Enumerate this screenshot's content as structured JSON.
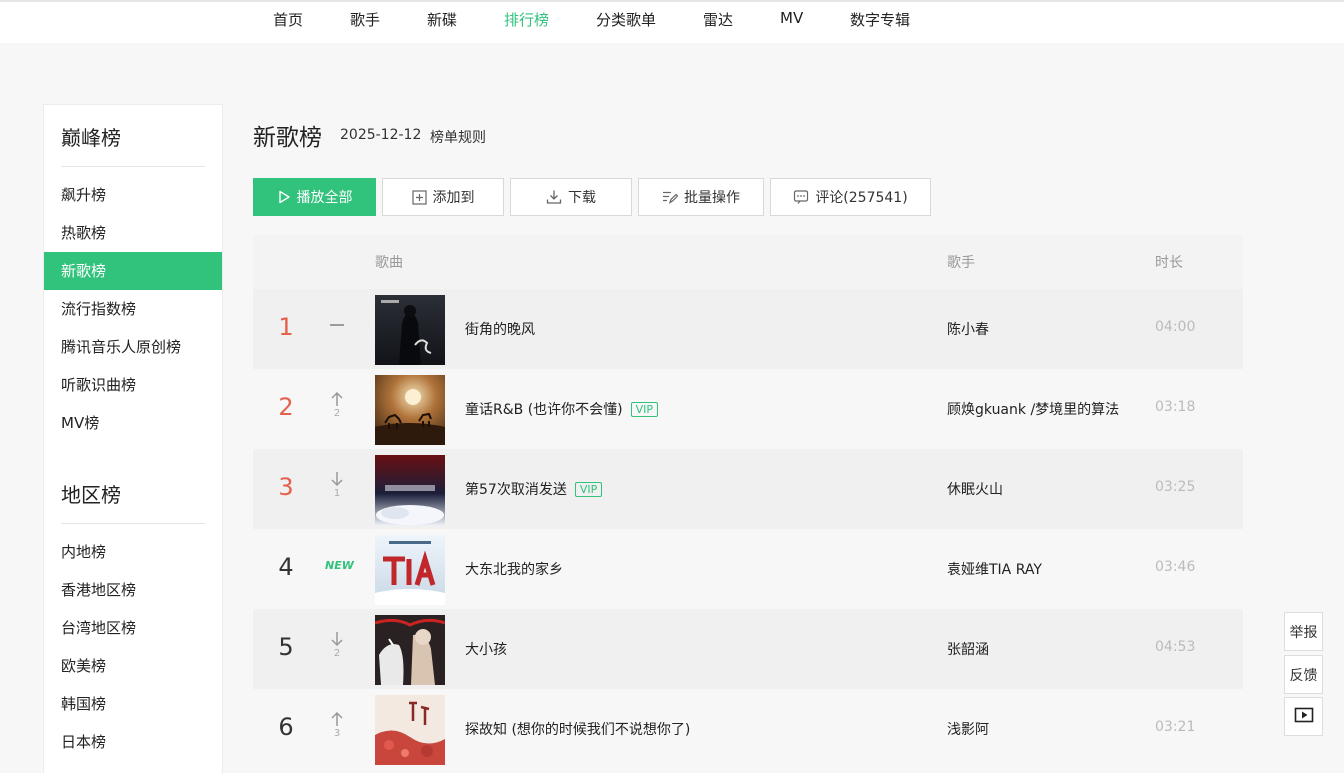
{
  "nav": {
    "items": [
      {
        "label": "首页",
        "active": false
      },
      {
        "label": "歌手",
        "active": false
      },
      {
        "label": "新碟",
        "active": false
      },
      {
        "label": "排行榜",
        "active": true
      },
      {
        "label": "分类歌单",
        "active": false
      },
      {
        "label": "雷达",
        "active": false
      },
      {
        "label": "MV",
        "active": false
      },
      {
        "label": "数字专辑",
        "active": false
      }
    ]
  },
  "sidebar": {
    "groups": [
      {
        "title": "巅峰榜",
        "items": [
          "飙升榜",
          "热歌榜",
          "新歌榜",
          "流行指数榜",
          "腾讯音乐人原创榜",
          "听歌识曲榜",
          "MV榜"
        ],
        "active": "新歌榜"
      },
      {
        "title": "地区榜",
        "items": [
          "内地榜",
          "香港地区榜",
          "台湾地区榜",
          "欧美榜",
          "韩国榜",
          "日本榜"
        ]
      }
    ]
  },
  "main": {
    "title": "新歌榜",
    "date": "2025-12-12",
    "rule_link": "榜单规则"
  },
  "toolbar": {
    "play_all": "播放全部",
    "add_to": "添加到",
    "download": "下载",
    "batch": "批量操作",
    "comment": "评论(257541)"
  },
  "table": {
    "headers": {
      "song": "歌曲",
      "singer": "歌手",
      "duration": "时长"
    },
    "rows": [
      {
        "rank": "1",
        "trend": "flat",
        "trend_num": "",
        "song": "街角的晚风",
        "vip": false,
        "vip_label": "",
        "singer": "陈小春",
        "duration": "04:00"
      },
      {
        "rank": "2",
        "trend": "up",
        "trend_num": "2",
        "song": "童话R&B (也许你不会懂)",
        "vip": true,
        "vip_label": "VIP",
        "singer": "顾焕gkuank /梦境里的算法",
        "duration": "03:18"
      },
      {
        "rank": "3",
        "trend": "down",
        "trend_num": "1",
        "song": "第57次取消发送",
        "vip": true,
        "vip_label": "VIP",
        "singer": "休眠火山",
        "duration": "03:25"
      },
      {
        "rank": "4",
        "trend": "new",
        "trend_num": "NEW",
        "song": "大东北我的家乡",
        "vip": false,
        "vip_label": "",
        "singer": "袁娅维TIA RAY",
        "duration": "03:46"
      },
      {
        "rank": "5",
        "trend": "down",
        "trend_num": "2",
        "song": "大小孩",
        "vip": false,
        "vip_label": "",
        "singer": "张韶涵",
        "duration": "04:53"
      },
      {
        "rank": "6",
        "trend": "up",
        "trend_num": "3",
        "song": "探故知 (想你的时候我们不说想你了)",
        "vip": false,
        "vip_label": "",
        "singer": "浅影阿",
        "duration": "03:21"
      }
    ]
  },
  "float": {
    "report": "举报",
    "feedback": "反馈"
  },
  "colors": {
    "accent": "#31c27c",
    "rank_top": "#e55f4c"
  }
}
